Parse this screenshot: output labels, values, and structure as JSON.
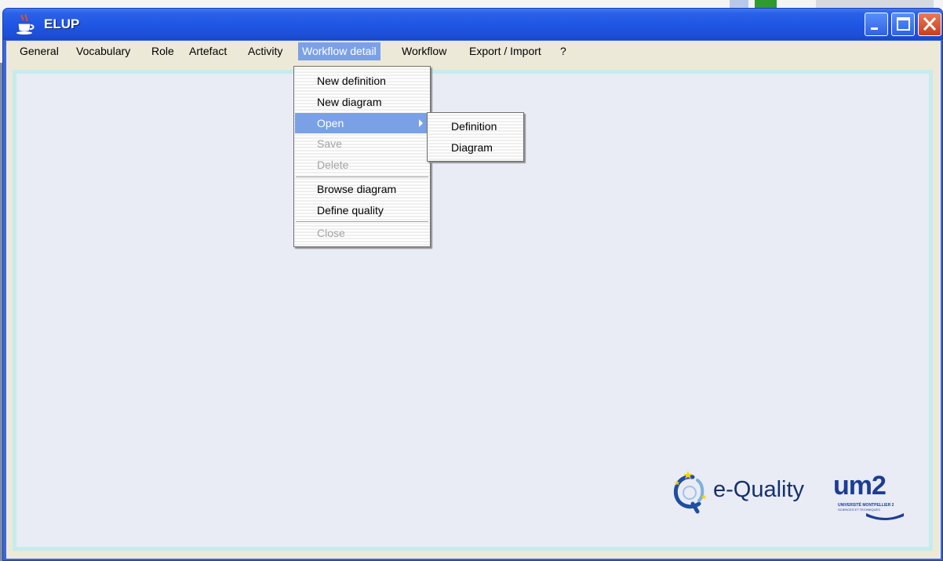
{
  "window": {
    "title": "ELUP"
  },
  "menubar": {
    "items": [
      {
        "label": "General"
      },
      {
        "label": "Vocabulary"
      },
      {
        "label": "Role"
      },
      {
        "label": "Artefact"
      },
      {
        "label": "Activity"
      },
      {
        "label": "Workflow detail",
        "active": true
      },
      {
        "label": "Workflow"
      },
      {
        "label": "Export / Import"
      },
      {
        "label": "?"
      }
    ]
  },
  "dropdown": {
    "items": [
      {
        "label": "New definition",
        "enabled": true
      },
      {
        "label": "New diagram",
        "enabled": true
      },
      {
        "label": "Open",
        "enabled": true,
        "highlighted": true,
        "submenu": true
      },
      {
        "label": "Save",
        "enabled": false
      },
      {
        "label": "Delete",
        "enabled": false
      },
      {
        "label": "Browse diagram",
        "enabled": true
      },
      {
        "label": "Define quality",
        "enabled": true
      },
      {
        "label": "Close",
        "enabled": false
      }
    ]
  },
  "submenu": {
    "items": [
      {
        "label": "Definition"
      },
      {
        "label": "Diagram"
      }
    ]
  },
  "logos": {
    "equality": "e-Quality",
    "um2": "um2",
    "um2_line1": "UNIVERSITÉ MONTPELLIER 2",
    "um2_line2": "SCIENCES ET TECHNIQUES"
  },
  "colors": {
    "titlebar": "#1f55e3",
    "menu_highlight": "#7aa1e6",
    "content_bg": "#e9ebf5",
    "content_border": "#c5ecee"
  },
  "icons": {
    "app": "java-cup-icon",
    "minimize": "minimize-icon",
    "maximize": "maximize-icon",
    "close": "close-icon",
    "submenu_arrow": "arrow-right-icon"
  }
}
